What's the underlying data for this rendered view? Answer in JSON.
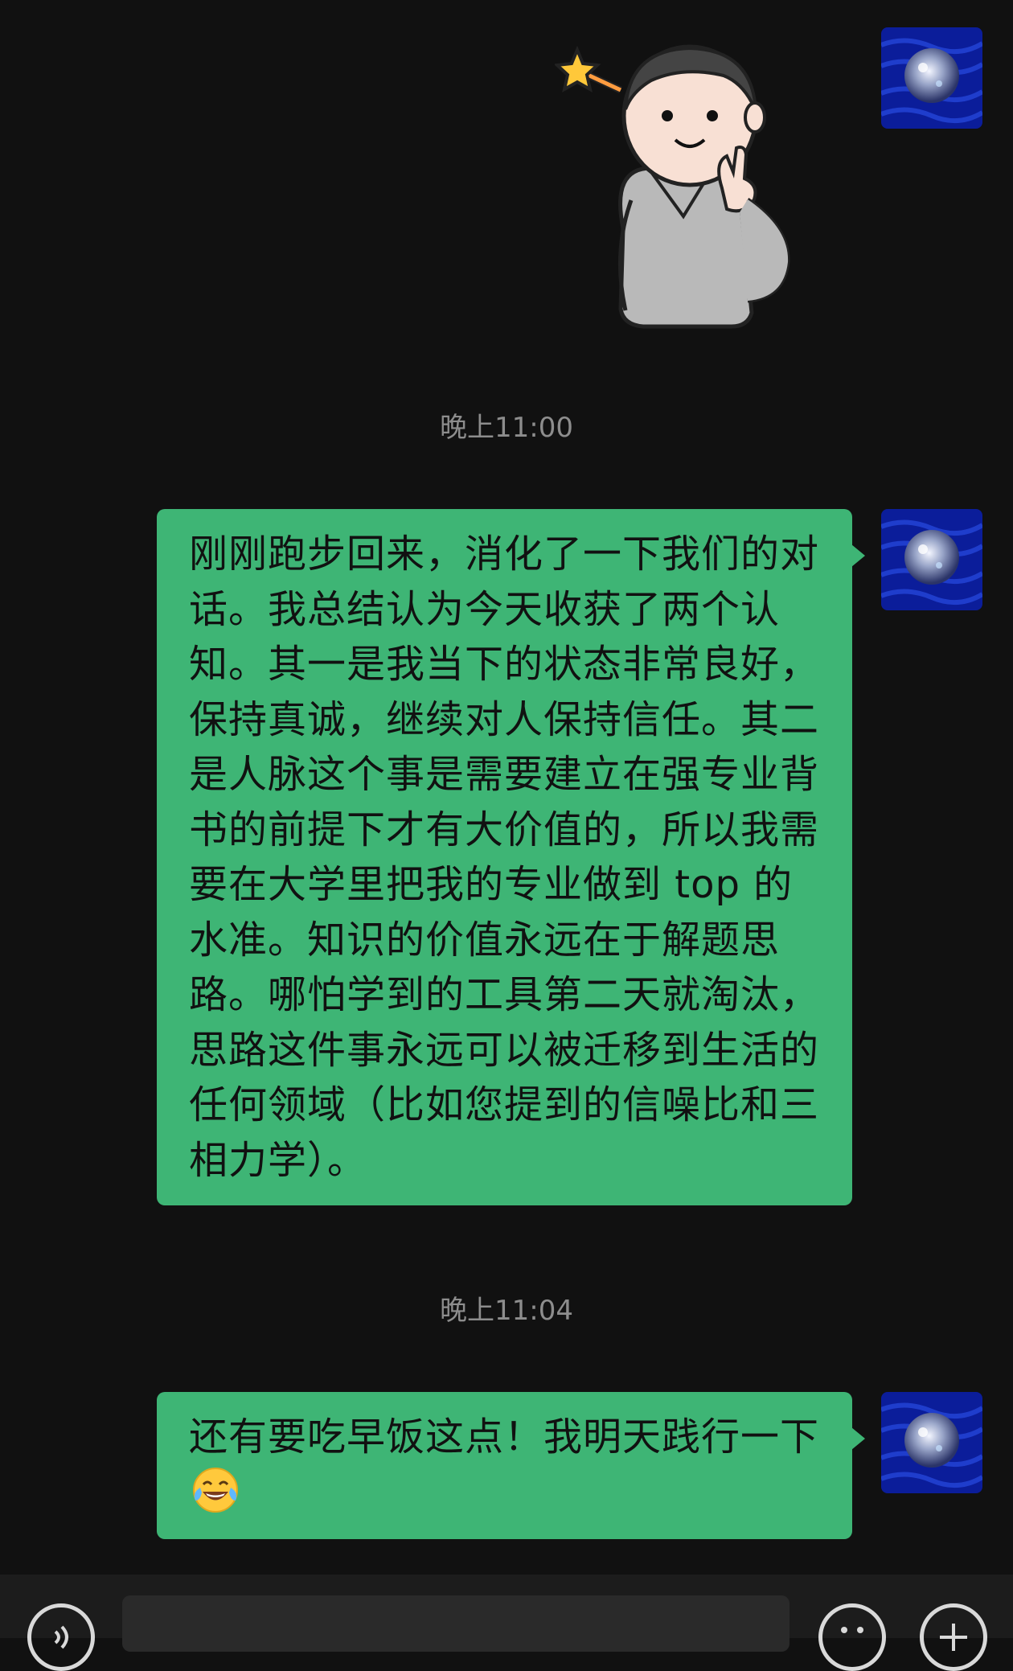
{
  "conversation": {
    "messages": [
      {
        "type": "sticker",
        "sender": "self",
        "sticker_icon": "boy-peace-sign-sticker"
      },
      {
        "type": "timestamp",
        "text": "晚上11:00"
      },
      {
        "type": "text",
        "sender": "self",
        "text": "刚刚跑步回来，消化了一下我们的对话。我总结认为今天收获了两个认知。其一是我当下的状态非常良好，保持真诚，继续对人保持信任。其二是人脉这个事是需要建立在强专业背书的前提下才有大价值的，所以我需要在大学里把我的专业做到 top 的水准。知识的价值永远在于解题思路。哪怕学到的工具第二天就淘汰，思路这件事永远可以被迁移到生活的任何领域（比如您提到的信噪比和三相力学）。"
      },
      {
        "type": "timestamp",
        "text": "晚上11:04"
      },
      {
        "type": "text",
        "sender": "self",
        "text": "还有要吃早饭这点！我明天践行一下",
        "emoji": "tears-of-joy-emoji"
      }
    ]
  },
  "colors": {
    "background": "#111111",
    "bubble_self": "#3eb575",
    "timestamp_text": "#8d8d8d",
    "input_bar": "#1c1c1c"
  },
  "input_bar": {
    "left_icon": "voice-icon",
    "right_icons": [
      "emoji-icon",
      "plus-icon"
    ]
  }
}
